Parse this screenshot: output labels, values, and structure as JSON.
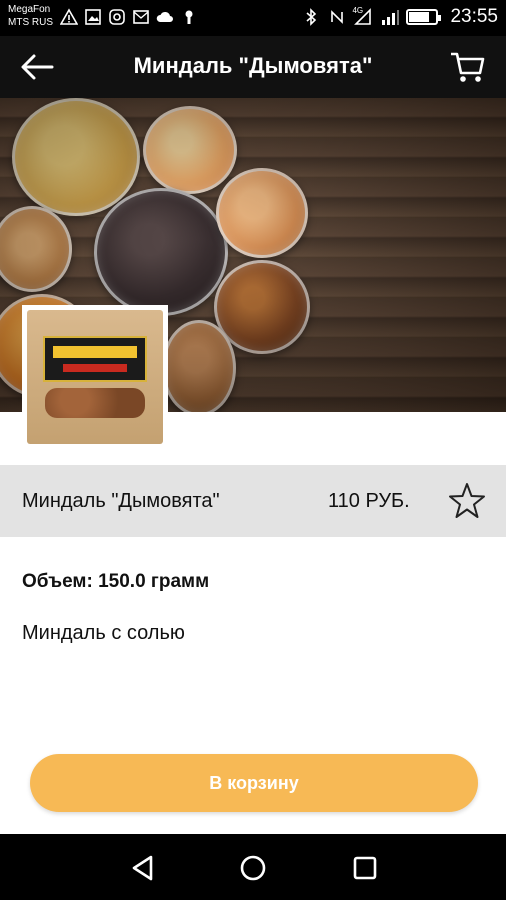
{
  "status_bar": {
    "carrier_1": "MegaFon",
    "carrier_2": "MTS RUS",
    "left_icons": [
      "warning-icon",
      "image-icon",
      "instagram-icon",
      "mail-icon",
      "cloud-icon",
      "keyhole-icon"
    ],
    "network_type": "4G",
    "battery_level": 0.7,
    "time": "23:55"
  },
  "app_bar": {
    "title": "Миндаль \"Дымовята\"",
    "back_icon": "arrow-left-icon",
    "cart_icon": "cart-icon"
  },
  "product": {
    "name": "Миндаль \"Дымовята\"",
    "price": "110 РУБ.",
    "favorite_icon": "star-outline-icon",
    "volume_label": "Объем:",
    "volume_value": "150.0 грамм",
    "description": "Миндаль с солью"
  },
  "actions": {
    "add_to_cart_label": "В корзину"
  },
  "colors": {
    "accent": "#f7b955",
    "row_background": "#e3e3e3",
    "app_bar": "#111111"
  }
}
